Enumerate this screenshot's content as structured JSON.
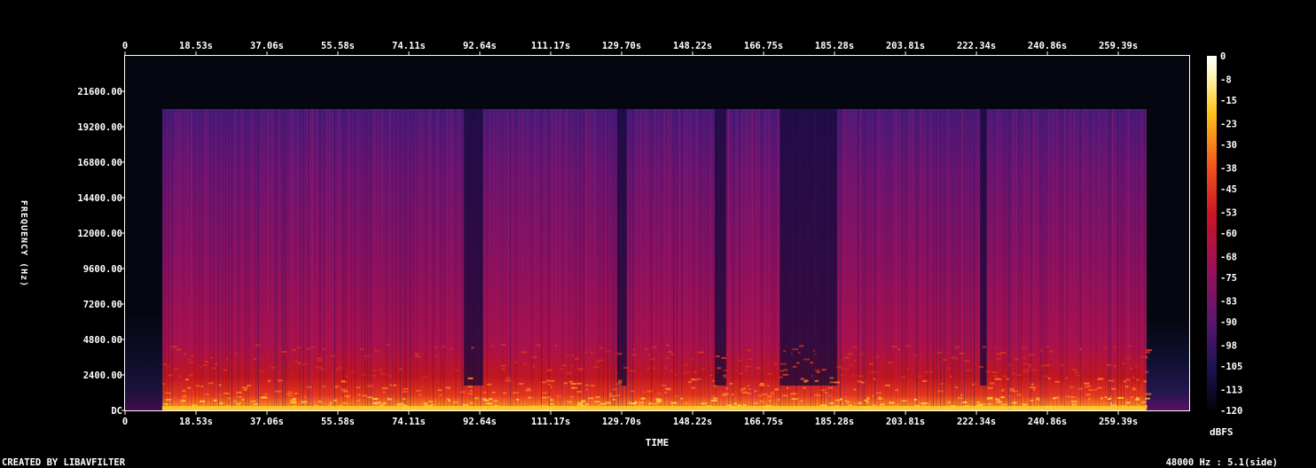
{
  "chart_data": {
    "type": "heatmap",
    "title": "",
    "xlabel": "TIME",
    "ylabel": "FREQUENCY (Hz)",
    "x_ticks": [
      "0",
      "18.53s",
      "37.06s",
      "55.58s",
      "74.11s",
      "92.64s",
      "111.17s",
      "129.70s",
      "148.22s",
      "166.75s",
      "185.28s",
      "203.81s",
      "222.34s",
      "240.86s",
      "259.39s"
    ],
    "x_tick_values": [
      0,
      18.53,
      37.06,
      55.58,
      74.11,
      92.64,
      111.17,
      129.7,
      148.22,
      166.75,
      185.28,
      203.81,
      222.34,
      240.86,
      259.39
    ],
    "xlim": [
      0,
      277.9
    ],
    "y_ticks": [
      "DC",
      "2400.00",
      "4800.00",
      "7200.00",
      "9600.00",
      "12000.00",
      "14400.00",
      "16800.00",
      "19200.00",
      "21600.00"
    ],
    "y_tick_values": [
      0,
      2400,
      4800,
      7200,
      9600,
      12000,
      14400,
      16800,
      19200,
      21600
    ],
    "ylim": [
      0,
      24000
    ],
    "colorbar": {
      "label": "dBFS",
      "ticks": [
        "0",
        "-8",
        "-15",
        "-23",
        "-30",
        "-38",
        "-45",
        "-53",
        "-60",
        "-68",
        "-75",
        "-83",
        "-90",
        "-98",
        "-105",
        "-113",
        "-120"
      ],
      "tick_values": [
        0,
        -8,
        -15,
        -23,
        -30,
        -38,
        -45,
        -53,
        -60,
        -68,
        -75,
        -83,
        -90,
        -98,
        -105,
        -113,
        -120
      ],
      "range": [
        -120,
        0
      ]
    },
    "content": {
      "start_s": 9.7,
      "end_s": 266.7,
      "tail_end_s": 277.9,
      "cutoff_hz": 20400,
      "quiet_sections_s": [
        [
          88.5,
          93.5
        ],
        [
          128.5,
          131
        ],
        [
          154,
          157
        ],
        [
          171,
          186
        ],
        [
          223.3,
          225
        ]
      ]
    },
    "footer_left": "CREATED BY LIBAVFILTER",
    "footer_right": "48000 Hz : 5.1(side)"
  }
}
